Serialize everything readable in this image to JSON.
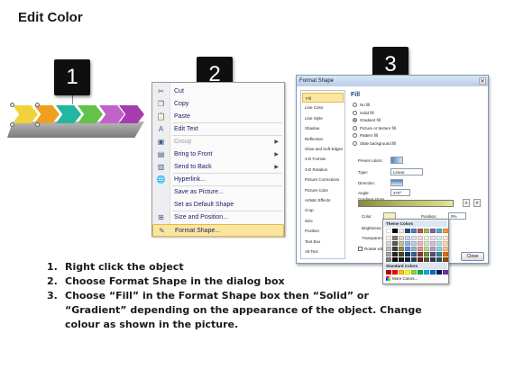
{
  "title": "Edit Color",
  "steps": [
    "1",
    "2",
    "3"
  ],
  "chevron_colors": [
    "#f2d23c",
    "#f0a020",
    "#22b8a0",
    "#62c24a",
    "#c062c8",
    "#a63cae"
  ],
  "context_menu": {
    "items": [
      {
        "label": "Cut",
        "icon": "scissors-icon",
        "glyph": "✂",
        "disabled": false,
        "submenu": false,
        "highlight": false
      },
      {
        "label": "Copy",
        "icon": "copy-icon",
        "glyph": "❐",
        "disabled": false,
        "submenu": false,
        "highlight": false
      },
      {
        "label": "Paste",
        "icon": "paste-icon",
        "glyph": "📋",
        "disabled": false,
        "submenu": false,
        "highlight": false
      },
      {
        "label": "Edit Text",
        "icon": "edit-text-icon",
        "glyph": "A",
        "disabled": false,
        "submenu": false,
        "highlight": false
      },
      {
        "label": "Group",
        "icon": "group-icon",
        "glyph": "▣",
        "disabled": true,
        "submenu": true,
        "highlight": false
      },
      {
        "label": "Bring to Front",
        "icon": "bring-front-icon",
        "glyph": "▤",
        "disabled": false,
        "submenu": true,
        "highlight": false
      },
      {
        "label": "Send to Back",
        "icon": "send-back-icon",
        "glyph": "▥",
        "disabled": false,
        "submenu": true,
        "highlight": false
      },
      {
        "label": "Hyperlink...",
        "icon": "hyperlink-icon",
        "glyph": "🌐",
        "disabled": false,
        "submenu": false,
        "highlight": false
      },
      {
        "label": "Save as Picture...",
        "icon": "",
        "glyph": "",
        "disabled": false,
        "submenu": false,
        "highlight": false
      },
      {
        "label": "Set as Default Shape",
        "icon": "",
        "glyph": "",
        "disabled": false,
        "submenu": false,
        "highlight": false
      },
      {
        "label": "Size and Position...",
        "icon": "size-position-icon",
        "glyph": "⊞",
        "disabled": false,
        "submenu": false,
        "highlight": false
      },
      {
        "label": "Format Shape...",
        "icon": "format-shape-icon",
        "glyph": "✎",
        "disabled": false,
        "submenu": false,
        "highlight": true
      }
    ]
  },
  "dialog": {
    "title": "Format Shape",
    "close_label": "Close",
    "nav_items": [
      "Fill",
      "Line Color",
      "Line Style",
      "Shadow",
      "Reflection",
      "Glow and Soft Edges",
      "3-D Format",
      "3-D Rotation",
      "Picture Corrections",
      "Picture Color",
      "Artistic Effects",
      "Crop",
      "Size",
      "Position",
      "Text Box",
      "Alt Text"
    ],
    "fill_heading": "Fill",
    "fill_options": [
      "No fill",
      "Solid fill",
      "Gradient fill",
      "Picture or texture fill",
      "Pattern fill",
      "Slide background fill"
    ],
    "selected_fill": 2,
    "preset_colors_label": "Preset colors:",
    "type_label": "Type:",
    "type_value": "Linear",
    "direction_label": "Direction:",
    "angle_label": "Angle:",
    "angle_value": "270°",
    "gradient_stops_label": "Gradient stops",
    "color_label": "Color",
    "position_label": "Position:",
    "position_value": "0%",
    "brightness_label": "Brightness:",
    "transparency_label": "Transparency:",
    "rotate_label": "Rotate with shape"
  },
  "picker": {
    "theme_label": "Theme Colors",
    "standard_label": "Standard Colors",
    "more_label": "More Colors...",
    "theme_top": [
      "#ffffff",
      "#000000",
      "#eeece1",
      "#1f497d",
      "#4f81bd",
      "#c0504d",
      "#9bbb59",
      "#8064a2",
      "#4bacc6",
      "#f79646"
    ],
    "theme_shades": [
      [
        "#f2f2f2",
        "#7f7f7f",
        "#ddd9c3",
        "#c6d9f0",
        "#dbe5f1",
        "#f2dcdb",
        "#ebf1dd",
        "#e5e0ec",
        "#dbeef3",
        "#fdeada"
      ],
      [
        "#d8d8d8",
        "#595959",
        "#c4bd97",
        "#8db3e2",
        "#b8cce4",
        "#e5b9b7",
        "#d7e3bc",
        "#ccc1d9",
        "#b7dde8",
        "#fbd5b5"
      ],
      [
        "#bfbfbf",
        "#3f3f3f",
        "#938953",
        "#548dd4",
        "#95b3d7",
        "#d99694",
        "#c3d69b",
        "#b2a2c7",
        "#92cddc",
        "#fac08f"
      ],
      [
        "#a5a5a5",
        "#262626",
        "#494429",
        "#17365d",
        "#366092",
        "#953734",
        "#76923c",
        "#5f497a",
        "#31859b",
        "#e36c09"
      ],
      [
        "#7f7f7f",
        "#0c0c0c",
        "#1d1b10",
        "#0f243e",
        "#244061",
        "#632423",
        "#4f6128",
        "#3f3151",
        "#205867",
        "#974806"
      ]
    ],
    "standard": [
      "#c00000",
      "#ff0000",
      "#ffc000",
      "#ffff00",
      "#92d050",
      "#00b050",
      "#00b0f0",
      "#0070c0",
      "#002060",
      "#7030a0"
    ]
  },
  "instructions": [
    {
      "num": "1.",
      "text": "Right click the object"
    },
    {
      "num": "2.",
      "text": "Choose Format Shape in the dialog box"
    },
    {
      "num": "3.",
      "text": "Choose “Fill” in the Format Shape box then “Solid” or “Gradient” depending on the appearance of the object. Change colour as shown in the picture."
    }
  ]
}
